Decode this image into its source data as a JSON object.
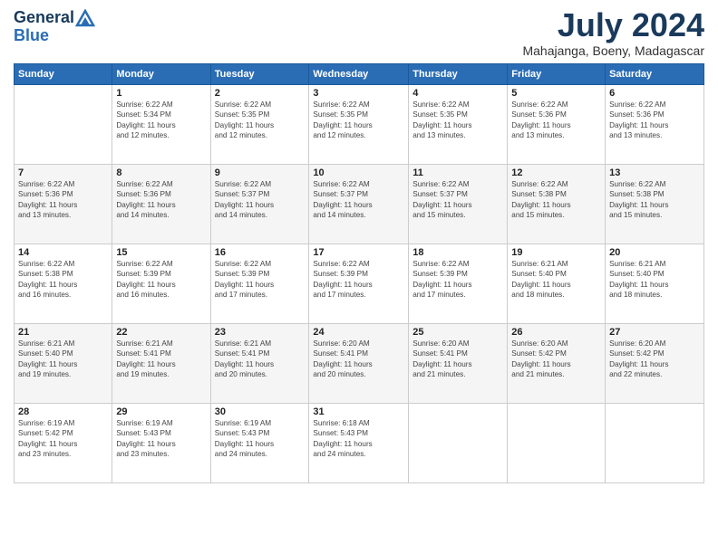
{
  "header": {
    "logo_line1": "General",
    "logo_line2": "Blue",
    "month_title": "July 2024",
    "location": "Mahajanga, Boeny, Madagascar"
  },
  "weekdays": [
    "Sunday",
    "Monday",
    "Tuesday",
    "Wednesday",
    "Thursday",
    "Friday",
    "Saturday"
  ],
  "weeks": [
    [
      {
        "day": "",
        "info": ""
      },
      {
        "day": "1",
        "info": "Sunrise: 6:22 AM\nSunset: 5:34 PM\nDaylight: 11 hours\nand 12 minutes."
      },
      {
        "day": "2",
        "info": "Sunrise: 6:22 AM\nSunset: 5:35 PM\nDaylight: 11 hours\nand 12 minutes."
      },
      {
        "day": "3",
        "info": "Sunrise: 6:22 AM\nSunset: 5:35 PM\nDaylight: 11 hours\nand 12 minutes."
      },
      {
        "day": "4",
        "info": "Sunrise: 6:22 AM\nSunset: 5:35 PM\nDaylight: 11 hours\nand 13 minutes."
      },
      {
        "day": "5",
        "info": "Sunrise: 6:22 AM\nSunset: 5:36 PM\nDaylight: 11 hours\nand 13 minutes."
      },
      {
        "day": "6",
        "info": "Sunrise: 6:22 AM\nSunset: 5:36 PM\nDaylight: 11 hours\nand 13 minutes."
      }
    ],
    [
      {
        "day": "7",
        "info": "Sunrise: 6:22 AM\nSunset: 5:36 PM\nDaylight: 11 hours\nand 13 minutes."
      },
      {
        "day": "8",
        "info": "Sunrise: 6:22 AM\nSunset: 5:36 PM\nDaylight: 11 hours\nand 14 minutes."
      },
      {
        "day": "9",
        "info": "Sunrise: 6:22 AM\nSunset: 5:37 PM\nDaylight: 11 hours\nand 14 minutes."
      },
      {
        "day": "10",
        "info": "Sunrise: 6:22 AM\nSunset: 5:37 PM\nDaylight: 11 hours\nand 14 minutes."
      },
      {
        "day": "11",
        "info": "Sunrise: 6:22 AM\nSunset: 5:37 PM\nDaylight: 11 hours\nand 15 minutes."
      },
      {
        "day": "12",
        "info": "Sunrise: 6:22 AM\nSunset: 5:38 PM\nDaylight: 11 hours\nand 15 minutes."
      },
      {
        "day": "13",
        "info": "Sunrise: 6:22 AM\nSunset: 5:38 PM\nDaylight: 11 hours\nand 15 minutes."
      }
    ],
    [
      {
        "day": "14",
        "info": "Sunrise: 6:22 AM\nSunset: 5:38 PM\nDaylight: 11 hours\nand 16 minutes."
      },
      {
        "day": "15",
        "info": "Sunrise: 6:22 AM\nSunset: 5:39 PM\nDaylight: 11 hours\nand 16 minutes."
      },
      {
        "day": "16",
        "info": "Sunrise: 6:22 AM\nSunset: 5:39 PM\nDaylight: 11 hours\nand 17 minutes."
      },
      {
        "day": "17",
        "info": "Sunrise: 6:22 AM\nSunset: 5:39 PM\nDaylight: 11 hours\nand 17 minutes."
      },
      {
        "day": "18",
        "info": "Sunrise: 6:22 AM\nSunset: 5:39 PM\nDaylight: 11 hours\nand 17 minutes."
      },
      {
        "day": "19",
        "info": "Sunrise: 6:21 AM\nSunset: 5:40 PM\nDaylight: 11 hours\nand 18 minutes."
      },
      {
        "day": "20",
        "info": "Sunrise: 6:21 AM\nSunset: 5:40 PM\nDaylight: 11 hours\nand 18 minutes."
      }
    ],
    [
      {
        "day": "21",
        "info": "Sunrise: 6:21 AM\nSunset: 5:40 PM\nDaylight: 11 hours\nand 19 minutes."
      },
      {
        "day": "22",
        "info": "Sunrise: 6:21 AM\nSunset: 5:41 PM\nDaylight: 11 hours\nand 19 minutes."
      },
      {
        "day": "23",
        "info": "Sunrise: 6:21 AM\nSunset: 5:41 PM\nDaylight: 11 hours\nand 20 minutes."
      },
      {
        "day": "24",
        "info": "Sunrise: 6:20 AM\nSunset: 5:41 PM\nDaylight: 11 hours\nand 20 minutes."
      },
      {
        "day": "25",
        "info": "Sunrise: 6:20 AM\nSunset: 5:41 PM\nDaylight: 11 hours\nand 21 minutes."
      },
      {
        "day": "26",
        "info": "Sunrise: 6:20 AM\nSunset: 5:42 PM\nDaylight: 11 hours\nand 21 minutes."
      },
      {
        "day": "27",
        "info": "Sunrise: 6:20 AM\nSunset: 5:42 PM\nDaylight: 11 hours\nand 22 minutes."
      }
    ],
    [
      {
        "day": "28",
        "info": "Sunrise: 6:19 AM\nSunset: 5:42 PM\nDaylight: 11 hours\nand 23 minutes."
      },
      {
        "day": "29",
        "info": "Sunrise: 6:19 AM\nSunset: 5:43 PM\nDaylight: 11 hours\nand 23 minutes."
      },
      {
        "day": "30",
        "info": "Sunrise: 6:19 AM\nSunset: 5:43 PM\nDaylight: 11 hours\nand 24 minutes."
      },
      {
        "day": "31",
        "info": "Sunrise: 6:18 AM\nSunset: 5:43 PM\nDaylight: 11 hours\nand 24 minutes."
      },
      {
        "day": "",
        "info": ""
      },
      {
        "day": "",
        "info": ""
      },
      {
        "day": "",
        "info": ""
      }
    ]
  ]
}
